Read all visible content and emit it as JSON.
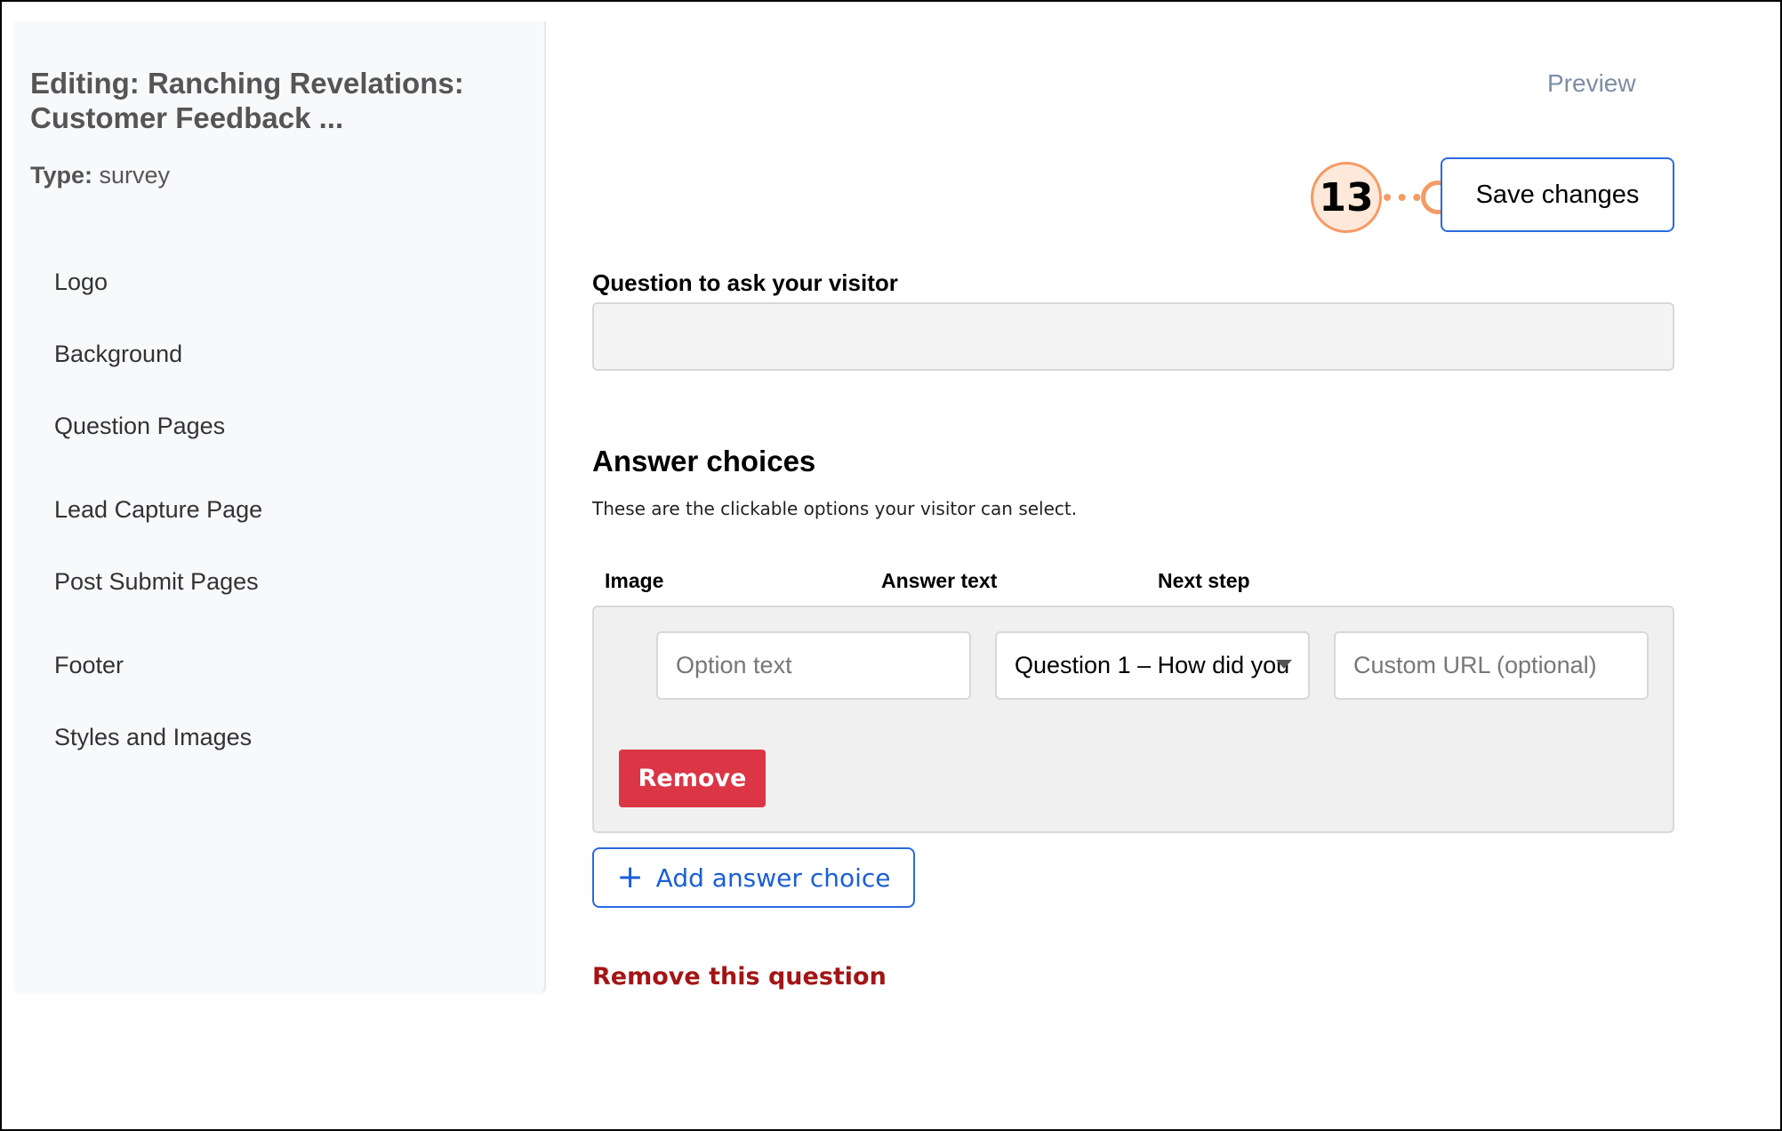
{
  "sidebar": {
    "title": "Editing: Ranching Revelations: Customer Feedback ...",
    "type_label": "Type:",
    "type_value": "survey",
    "items": [
      {
        "label": "Logo"
      },
      {
        "label": "Background"
      },
      {
        "label": "Question Pages"
      },
      {
        "label": "Lead Capture Page"
      },
      {
        "label": "Post Submit Pages"
      },
      {
        "label": "Footer"
      },
      {
        "label": "Styles and Images"
      }
    ]
  },
  "header": {
    "preview_label": "Preview",
    "save_label": "Save changes",
    "callout_number": "13",
    "callout_color": "#f59a63"
  },
  "question": {
    "label": "Question to ask your visitor",
    "value": ""
  },
  "answers": {
    "heading": "Answer choices",
    "description": "These are the clickable options your visitor can select.",
    "columns": [
      "Image",
      "Answer text",
      "Next step"
    ],
    "choice": {
      "option_placeholder": "Option text",
      "next_step_value": "Question 1 – How did you",
      "url_placeholder": "Custom URL (optional)",
      "remove_label": "Remove"
    },
    "add_label": "Add answer choice",
    "remove_question_label": "Remove this question"
  },
  "colors": {
    "accent": "#2a6ae0",
    "danger": "#dc3545",
    "danger_text": "#a31515"
  }
}
